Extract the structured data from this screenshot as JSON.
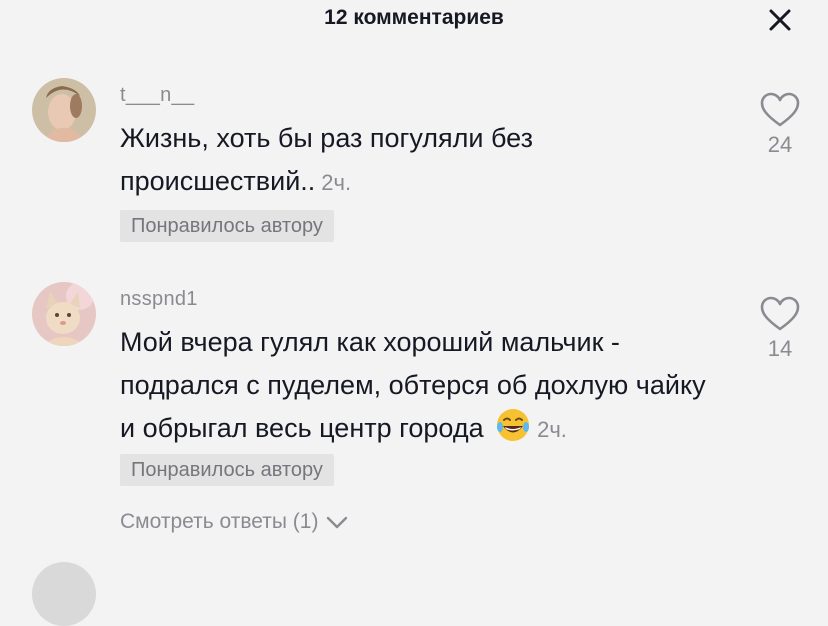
{
  "header": {
    "title": "12 комментариев",
    "close_icon": "close-icon"
  },
  "comments": [
    {
      "username": "t___n__",
      "text": "Жизнь, хоть бы раз погуляли без происшествий..",
      "time": "2ч.",
      "badge": "Понравилось автору",
      "likes": "24",
      "like_icon": "heart-outline-icon"
    },
    {
      "username": "nsspnd1",
      "text": "Мой вчера гулял как хороший мальчик - подрался с пуделем, обтерся об дохлую чайку и обрыгал весь центр города",
      "emoji": "😂",
      "time": "2ч.",
      "badge": "Понравилось автору",
      "likes": "14",
      "like_icon": "heart-outline-icon"
    }
  ],
  "view_replies": {
    "label": "Смотреть ответы (1)",
    "icon": "chevron-down-icon"
  },
  "colors": {
    "background": "#f3f3f3",
    "text_primary": "#161823",
    "text_secondary": "#8a8b91",
    "badge_bg": "#e3e3e4"
  }
}
